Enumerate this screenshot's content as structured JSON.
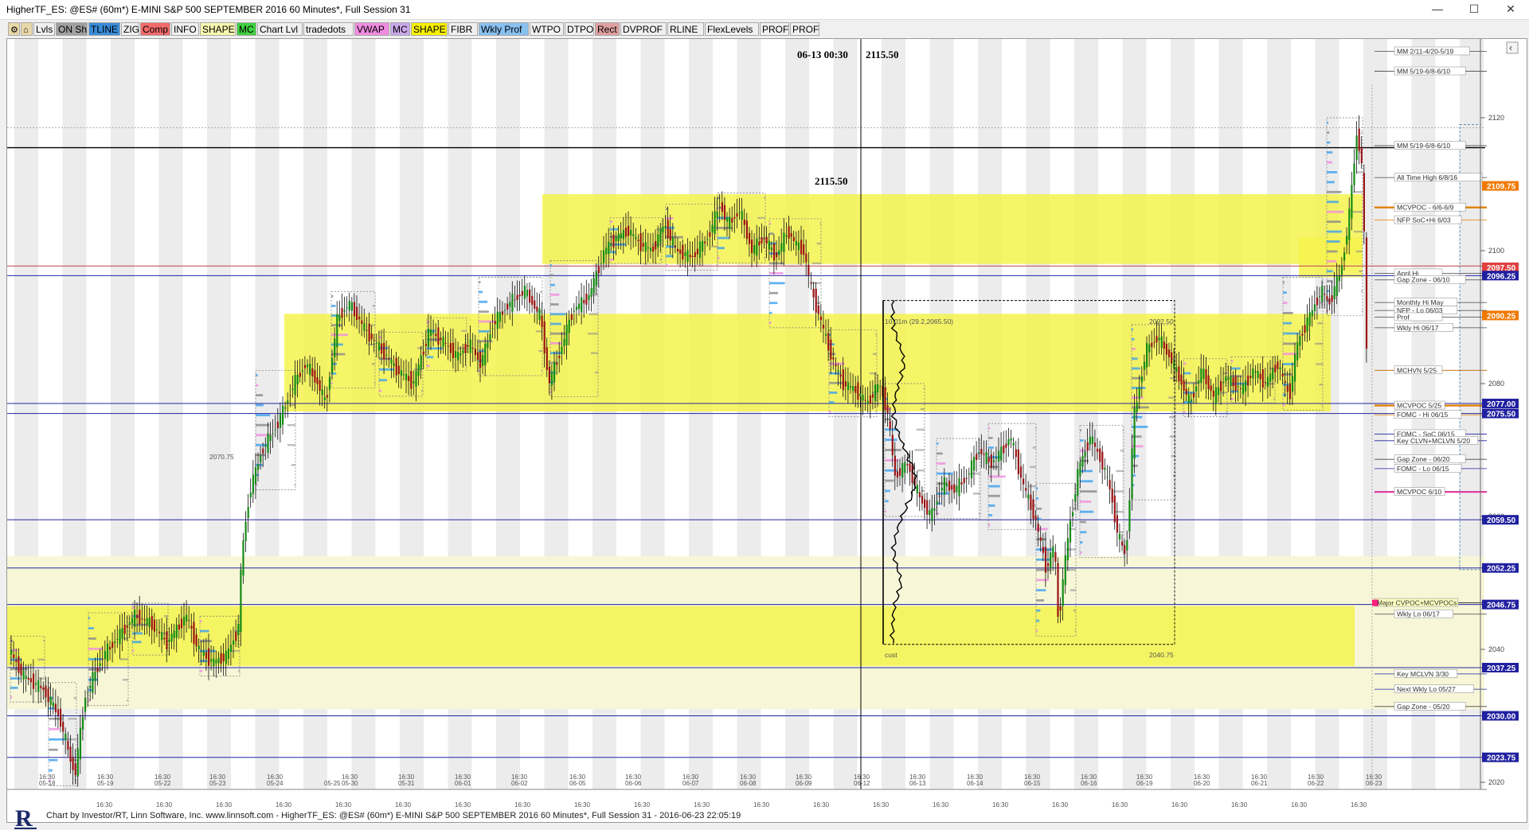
{
  "window": {
    "title": "HigherTF_ES: @ES# (60m*) E-MINI S&P 500 SEPTEMBER 2016 60 Minutes*, Full Session 31",
    "controls": {
      "minimize": "—",
      "maximize": "☐",
      "close": "✕"
    }
  },
  "toolbar": {
    "buttons": [
      {
        "label": "",
        "icon": "gear-icon",
        "bg": "#e8d8a8"
      },
      {
        "label": "",
        "icon": "home-icon",
        "bg": "#e8d8a8"
      },
      {
        "label": "Lvls",
        "bg": "#f0f0f0"
      },
      {
        "label": "ON Sh",
        "bg": "#a0a0a0"
      },
      {
        "label": "TLINE",
        "bg": "#3a8cd8"
      },
      {
        "label": "ZIG",
        "bg": "#f0f0f0"
      },
      {
        "label": "Comp",
        "bg": "#f26b6b"
      },
      {
        "label": "INFO",
        "bg": "#f0f0f0"
      },
      {
        "label": "SHAPE",
        "bg": "#f7f7b0"
      },
      {
        "label": "MC",
        "bg": "#40d040"
      },
      {
        "label": "Chart Lvl",
        "bg": "#f0f0f0"
      },
      {
        "label": "tradedots",
        "bg": "#f0f0f0"
      },
      {
        "label": "VWAP",
        "bg": "#f08ce0"
      },
      {
        "label": "MC",
        "bg": "#c8a8e8"
      },
      {
        "label": "SHAPE",
        "bg": "#f8f000"
      },
      {
        "label": "FIBR",
        "bg": "#f0f0f0"
      },
      {
        "label": "Wkly Prof",
        "bg": "#88c0f0"
      },
      {
        "label": "WTPO",
        "bg": "#f0f0f0"
      },
      {
        "label": "DTPO",
        "bg": "#f0f0f0"
      },
      {
        "label": "Rect",
        "bg": "#e0a0a0"
      },
      {
        "label": "DVPROF",
        "bg": "#f0f0f0"
      },
      {
        "label": "RLINE",
        "bg": "#f0f0f0"
      },
      {
        "label": "FlexLevels",
        "bg": "#f0f0f0"
      },
      {
        "label": "PROF",
        "bg": "#f0f0f0"
      },
      {
        "label": "PROF",
        "bg": "#f0f0f0"
      }
    ]
  },
  "chart": {
    "crosshair_label": "06-13 00:30",
    "crosshair_value": "2115.50",
    "crosshair_price_label": "2115.50",
    "profile_labels": {
      "high_vol": "10.01m (29.2,2065.50)",
      "high": "2092.50",
      "low": "2040.75",
      "cust": "cust",
      "left_level": "2070.75"
    },
    "price_axis_ticks": [
      "2120",
      "2100",
      "2080",
      "2060",
      "2040",
      "2020"
    ],
    "price_boxes": [
      {
        "text": "2109.75",
        "color": "#f07800"
      },
      {
        "text": "2097.50",
        "color": "#e04040"
      },
      {
        "text": "2096.25",
        "color": "#2020a0"
      },
      {
        "text": "2090.25",
        "color": "#f07800"
      },
      {
        "text": "2077.00",
        "color": "#2020a0"
      },
      {
        "text": "2075.50",
        "color": "#2020a0"
      },
      {
        "text": "2059.50",
        "color": "#2020a0"
      },
      {
        "text": "2052.25",
        "color": "#2020a0"
      },
      {
        "text": "2046.75",
        "color": "#2020a0"
      },
      {
        "text": "2037.25",
        "color": "#2020a0"
      },
      {
        "text": "2030.00",
        "color": "#2020a0"
      },
      {
        "text": "2023.75",
        "color": "#2020a0"
      }
    ],
    "level_labels": [
      "MM 2/11-4/20-5/19",
      "MM 5/19-6/8-6/10",
      "MM 5/19-6/8-6/10",
      "All Time High 6/8/16",
      "MCVPOC - 6/6-6/9",
      "NFP SoC+Hi 6/03",
      "April Hi",
      "Gap Zone - 06/10",
      "Monthly Hi May",
      "NFP - Lo 06/03",
      "Prof",
      "Wkly Hi 06/17",
      "MCHVN 5/25",
      "MCVPOC 5/25",
      "FOMC - Hi 06/15",
      "FOMC - SoC 06/15",
      "Key CLVN+MCLVN 5/20",
      "Gap Zone - 06/20",
      "FOMC - Lo 06/15",
      "MCVPOC 6/10",
      "Major CVPOC+MCVPOCs",
      "Wkly Lo 06/17",
      "Key MCLVN 3/30",
      "Next Wkly Lo 05/27",
      "Gap Zone - 05/20"
    ],
    "time_axis_top": [
      "16:30",
      "16:30",
      "16:30",
      "16:30",
      "16:30",
      "16:30",
      "16:30",
      "16:30",
      "16:30",
      "16:30",
      "16:30",
      "16:30",
      "16:30",
      "16:30",
      "16:30",
      "16:30",
      "16:30",
      "16:30",
      "16:30",
      "16:30",
      "16:30",
      "16:30",
      "16:30",
      "16:30"
    ],
    "time_axis_dates": [
      "05-18",
      "05-19",
      "05-22",
      "05-23",
      "05-24",
      "05-25",
      "05-30",
      "05-31",
      "06-01",
      "06-02",
      "06-05",
      "06-06",
      "06-07",
      "06-08",
      "06-09",
      "06-12",
      "06-13",
      "06-14",
      "06-15",
      "06-16",
      "06-19",
      "06-20",
      "06-21",
      "06-22",
      "06-23"
    ],
    "time_axis_bottom": [
      "16:30",
      "16:30",
      "16:30",
      "16:30",
      "16:30",
      "16:30",
      "16:30",
      "16:30",
      "16:30",
      "16:30",
      "16:30",
      "16:30",
      "16:30",
      "16:30",
      "16:30",
      "16:30",
      "16:30",
      "16:30",
      "16:30",
      "16:30",
      "16:30",
      "16:30",
      "16:30",
      "16:30",
      "16:30"
    ]
  },
  "footer": {
    "text": "Chart by Investor/RT, Linn Software, Inc. www.linnsoft.com - HigherTF_ES: @ES# (60m*) E-MINI S&P 500 SEPTEMBER 2016 60 Minutes*, Full Session 31 - 2016-06-23 22:05:19",
    "logo_letter": "R"
  }
}
